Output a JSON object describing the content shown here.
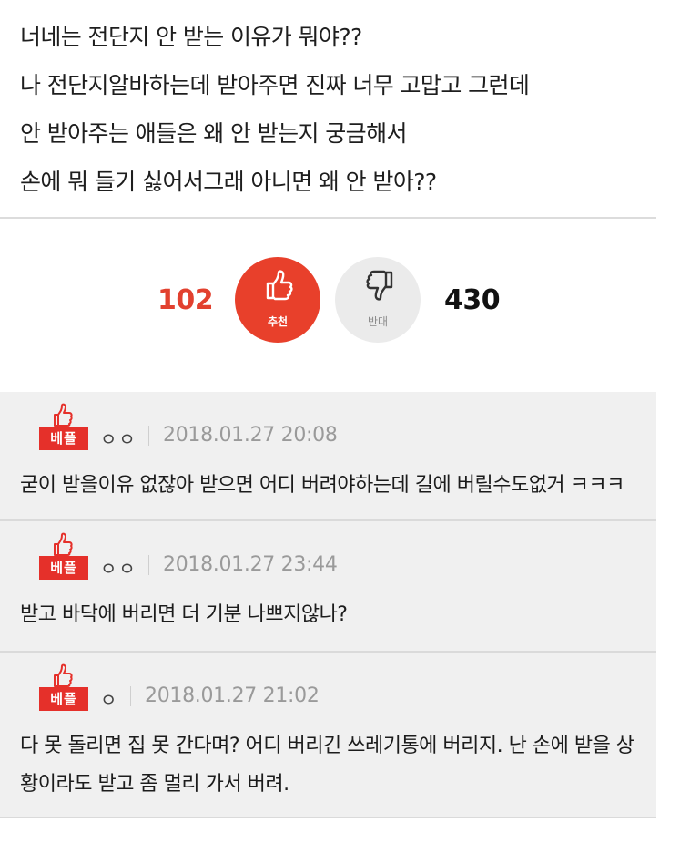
{
  "post": {
    "lines": [
      "너네는 전단지 안 받는 이유가 뭐야??",
      "나 전단지알바하는데 받아주면 진짜 너무 고맙고 그런데",
      "안 받아주는 애들은 왜 안 받는지 궁금해서",
      "손에 뭐 들기 싫어서그래 아니면 왜 안 받아??"
    ]
  },
  "votes": {
    "up_count": "102",
    "up_label": "추천",
    "down_count": "430",
    "down_label": "반대",
    "up_color": "#e8402b",
    "down_color": "#ebebeb"
  },
  "comments": [
    {
      "badge": "베플",
      "nick": "ㅇㅇ",
      "date": "2018.01.27 20:08",
      "text": "굳이 받을이유 없잖아 받으면 어디 버려야하는데 길에 버릴수도없거 ㅋㅋㅋ"
    },
    {
      "badge": "베플",
      "nick": "ㅇㅇ",
      "date": "2018.01.27 23:44",
      "text": "받고 바닥에 버리면 더 기분 나쁘지않나?"
    },
    {
      "badge": "베플",
      "nick": "ㅇ",
      "date": "2018.01.27 21:02",
      "text": "다 못 돌리면 집 못 간다며? 어디 버리긴 쓰레기통에 버리지. 난 손에 받을 상황이라도 받고 좀 멀리 가서 버려."
    }
  ],
  "colors": {
    "accent_red": "#e5302a",
    "comment_bg": "#f0f0f0",
    "date_gray": "#9a9a9a"
  }
}
